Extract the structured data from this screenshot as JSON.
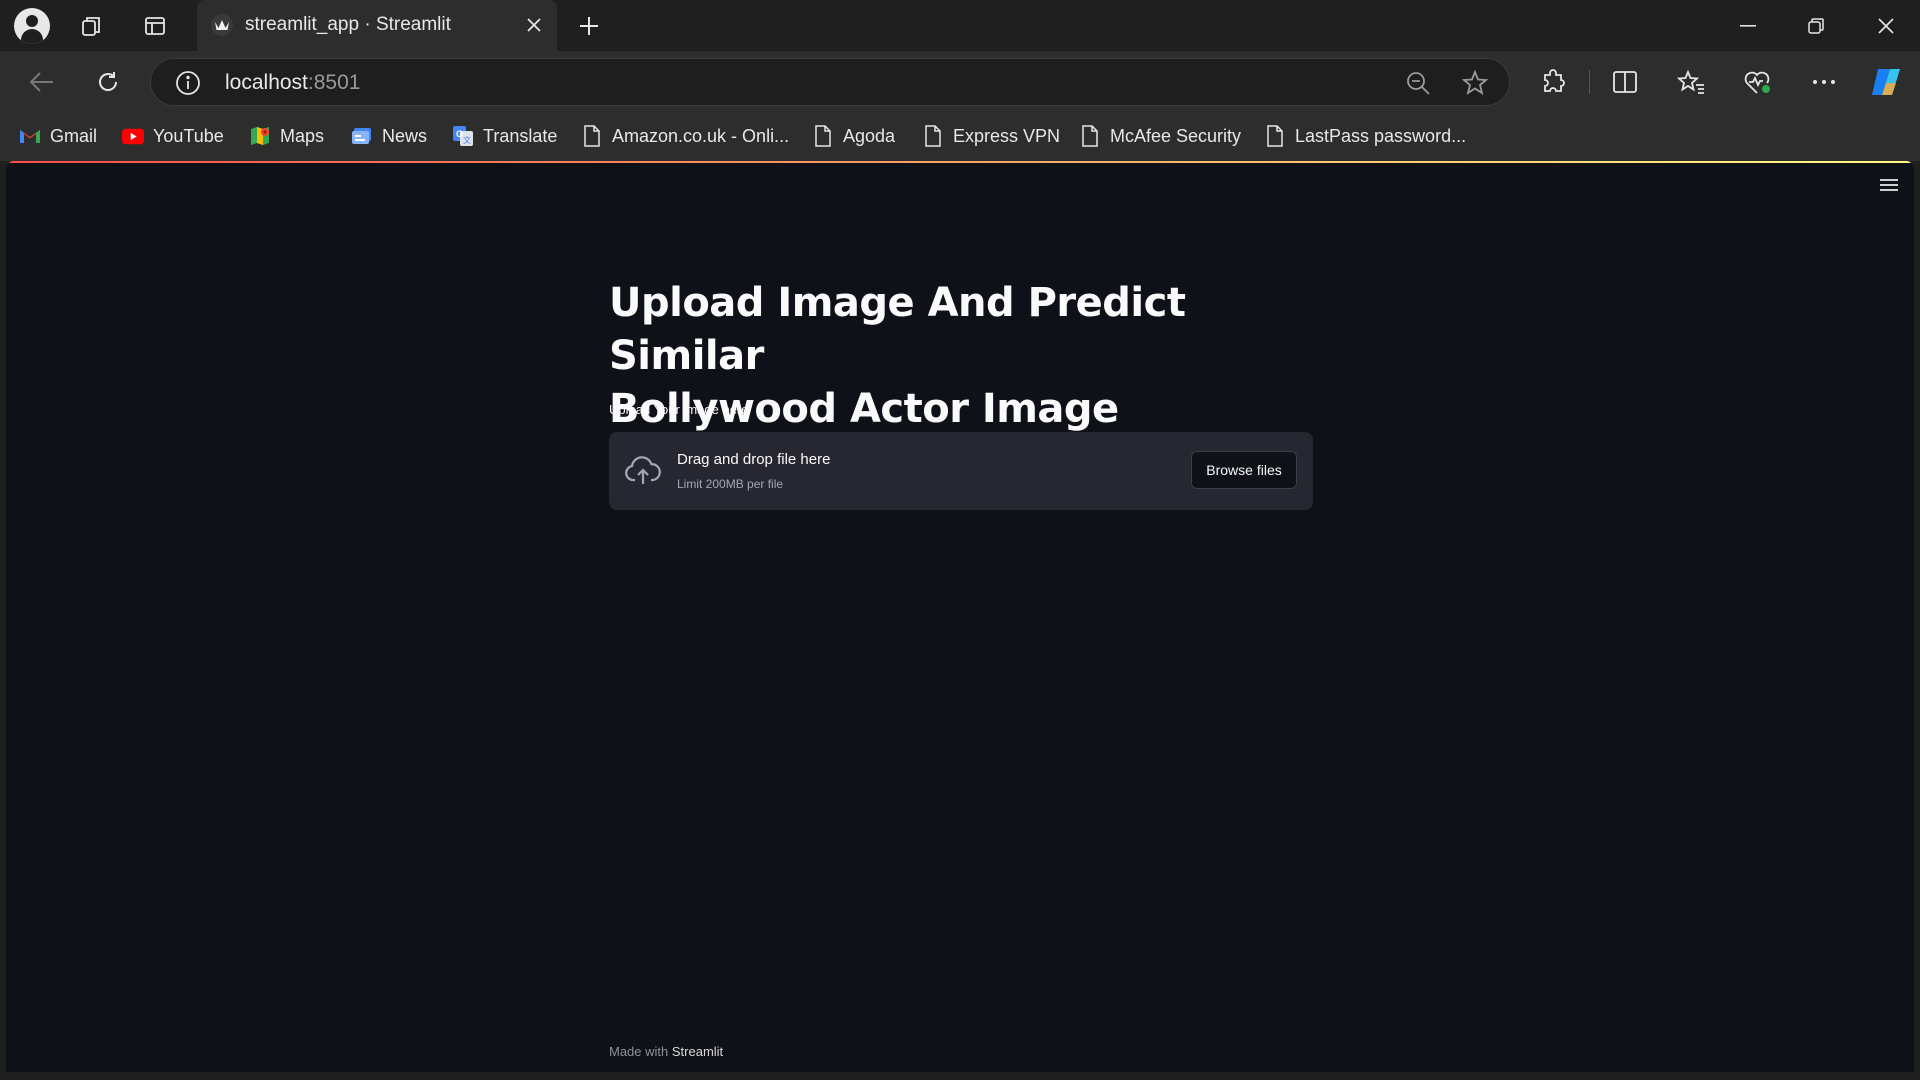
{
  "browser": {
    "tab_title": "streamlit_app · Streamlit",
    "url_host": "localhost",
    "url_port": ":8501"
  },
  "bookmarks": [
    {
      "label": "Gmail",
      "icon": "gmail-icon"
    },
    {
      "label": "YouTube",
      "icon": "youtube-icon"
    },
    {
      "label": "Maps",
      "icon": "maps-icon"
    },
    {
      "label": "News",
      "icon": "news-icon"
    },
    {
      "label": "Translate",
      "icon": "translate-icon"
    },
    {
      "label": "Amazon.co.uk - Onli...",
      "icon": "page-icon"
    },
    {
      "label": "Agoda",
      "icon": "page-icon"
    },
    {
      "label": "Express VPN",
      "icon": "page-icon"
    },
    {
      "label": "McAfee Security",
      "icon": "page-icon"
    },
    {
      "label": "LastPass password...",
      "icon": "page-icon"
    }
  ],
  "app": {
    "title_line1": "Upload Image And Predict Similar",
    "title_line2": "Bollywood Actor Image",
    "upload_label": "Upload Your image here",
    "dropzone_title": "Drag and drop file here",
    "dropzone_limit": "Limit 200MB per file",
    "browse_label": "Browse files",
    "footer_prefix": "Made with",
    "footer_brand": "Streamlit"
  },
  "colors": {
    "page_bg": "#0e1117",
    "dropzone_bg": "#262730",
    "accent": "#ff4b4b"
  }
}
